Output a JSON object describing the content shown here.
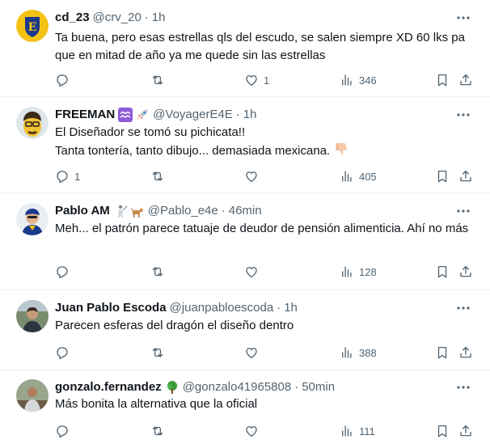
{
  "tweets": [
    {
      "name": "cd_23",
      "handle": "@crv_20",
      "time": "1h",
      "text": "Ta buena, pero esas estrellas qls del escudo, se salen siempre XD 60 lks pa que en mitad de año ya me quede sin las estrellas",
      "replies": "",
      "retweets": "",
      "likes": "1",
      "views": "346"
    },
    {
      "name": "FREEMAN",
      "badge_icons": [
        "aquarius-icon",
        "rocket-icon"
      ],
      "handle": "@VoyagerE4E",
      "time": "1h",
      "text_line1": "El Diseñador se tomó su pichicata!!",
      "text_line2": "Tanta tontería, tanto dibujo... demasiada mexicana.",
      "replies": "1",
      "retweets": "",
      "likes": "",
      "views": "405"
    },
    {
      "name": "Pablo AM",
      "badge_icons": [
        "fencer-icon",
        "dog-icon"
      ],
      "handle": "@Pablo_e4e",
      "time": "46min",
      "text": "Meh... el patrón parece tatuaje de deudor de pensión alimenticia. Ahí no más",
      "replies": "",
      "retweets": "",
      "likes": "",
      "views": "128"
    },
    {
      "name": "Juan Pablo Escoda",
      "handle": "@juanpabloescoda",
      "time": "1h",
      "text": "Parecen esferas del dragón el diseño dentro",
      "replies": "",
      "retweets": "",
      "likes": "",
      "views": "388"
    },
    {
      "name": "gonzalo.fernandez",
      "badge_icons": [
        "tree-icon"
      ],
      "handle": "@gonzalo41965808",
      "time": "50min",
      "text": "Más bonita la alternativa que la oficial",
      "replies": "",
      "retweets": "",
      "likes": "",
      "views": "111"
    }
  ],
  "separator": "·",
  "colors": {
    "text": "#0f1419",
    "muted": "#536471",
    "border": "#eff3f4"
  }
}
